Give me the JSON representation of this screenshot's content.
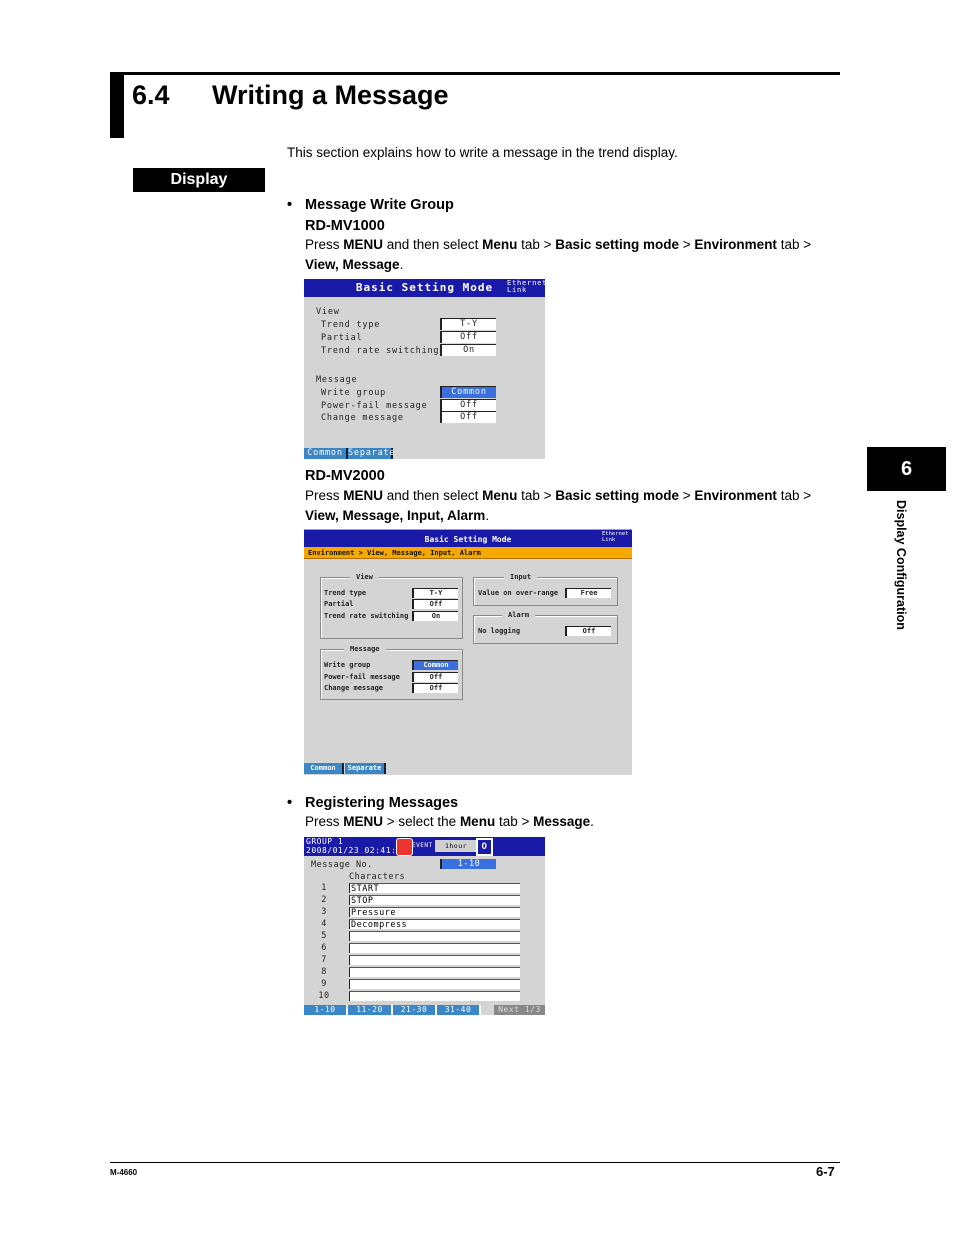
{
  "section": {
    "number": "6.4",
    "title": "Writing a Message",
    "intro": "This section explains how to write a message in the trend display."
  },
  "side_tag": "Display",
  "thumb": {
    "chapter": "6",
    "label": "Display Configuration"
  },
  "write_group": {
    "bullet": "•",
    "heading": "Message Write Group",
    "mv1000": {
      "model": "RD-MV1000",
      "instr": [
        {
          "t": "Press ",
          "b": false
        },
        {
          "t": "MENU",
          "b": true
        },
        {
          "t": " and then select ",
          "b": false
        },
        {
          "t": "Menu",
          "b": true
        },
        {
          "t": " tab > ",
          "b": false
        },
        {
          "t": "Basic setting mode",
          "b": true
        },
        {
          "t": " > ",
          "b": false
        },
        {
          "t": "Environment",
          "b": true
        },
        {
          "t": " tab > ",
          "b": false
        },
        {
          "t": "View, Message",
          "b": true
        },
        {
          "t": ".",
          "b": false
        }
      ],
      "screen": {
        "title": "Basic Setting Mode",
        "status": [
          "Ethernet",
          "Link"
        ],
        "view_label": "View",
        "view_rows": [
          {
            "label": "Trend type",
            "value": "T-Y"
          },
          {
            "label": "Partial",
            "value": "Off"
          },
          {
            "label": "Trend rate switching",
            "value": "On"
          }
        ],
        "message_label": "Message",
        "message_rows": [
          {
            "label": "Write group",
            "value": "Common",
            "selected": true
          },
          {
            "label": "Power-fail message",
            "value": "Off"
          },
          {
            "label": "Change message",
            "value": "Off"
          }
        ],
        "softkeys": [
          "Common",
          "Separate"
        ]
      }
    },
    "mv2000": {
      "model": "RD-MV2000",
      "instr": [
        {
          "t": "Press ",
          "b": false
        },
        {
          "t": "MENU",
          "b": true
        },
        {
          "t": " and then select ",
          "b": false
        },
        {
          "t": "Menu",
          "b": true
        },
        {
          "t": " tab > ",
          "b": false
        },
        {
          "t": "Basic setting mode",
          "b": true
        },
        {
          "t": " > ",
          "b": false
        },
        {
          "t": "Environment",
          "b": true
        },
        {
          "t": " tab > ",
          "b": false
        },
        {
          "t": "View, Message, Input, Alarm",
          "b": true
        },
        {
          "t": ".",
          "b": false
        }
      ],
      "screen": {
        "title": "Basic Setting Mode",
        "status": [
          "Ethernet",
          "Link"
        ],
        "breadcrumb": "Environment > View, Message, Input, Alarm",
        "view_label": "View",
        "view_rows": [
          {
            "label": "Trend type",
            "value": "T-Y"
          },
          {
            "label": "Partial",
            "value": "Off"
          },
          {
            "label": "Trend rate switching",
            "value": "On"
          }
        ],
        "message_label": "Message",
        "message_rows": [
          {
            "label": "Write group",
            "value": "Common",
            "selected": true
          },
          {
            "label": "Power-fail message",
            "value": "Off"
          },
          {
            "label": "Change message",
            "value": "Off"
          }
        ],
        "input_label": "Input",
        "input_rows": [
          {
            "label": "Value on over-range",
            "value": "Free"
          }
        ],
        "alarm_label": "Alarm",
        "alarm_rows": [
          {
            "label": "No logging",
            "value": "Off"
          }
        ],
        "softkeys": [
          "Common",
          "Separate"
        ]
      }
    }
  },
  "register": {
    "bullet": "•",
    "heading": "Registering Messages",
    "instr": [
      {
        "t": "Press ",
        "b": false
      },
      {
        "t": "MENU",
        "b": true
      },
      {
        "t": " > select the ",
        "b": false
      },
      {
        "t": "Menu",
        "b": true
      },
      {
        "t": " tab > ",
        "b": false
      },
      {
        "t": "Message",
        "b": true
      },
      {
        "t": ".",
        "b": false
      }
    ],
    "screen": {
      "group": "GROUP 1",
      "datetime": "2008/01/23 02:41:58",
      "event_label": "EVENT",
      "interval": "1hour",
      "camera_glyph": "O",
      "msgno_label": "Message No.",
      "msgno_value": "1-10",
      "chars_label": "Characters",
      "rows": [
        {
          "no": "1",
          "text": "START"
        },
        {
          "no": "2",
          "text": "STOP"
        },
        {
          "no": "3",
          "text": "Pressure"
        },
        {
          "no": "4",
          "text": "Decompress"
        },
        {
          "no": "5",
          "text": ""
        },
        {
          "no": "6",
          "text": ""
        },
        {
          "no": "7",
          "text": ""
        },
        {
          "no": "8",
          "text": ""
        },
        {
          "no": "9",
          "text": ""
        },
        {
          "no": "10",
          "text": ""
        }
      ],
      "softkeys": [
        "1-10",
        "11-20",
        "21-30",
        "31-40"
      ],
      "next": "Next 1/3"
    }
  },
  "footer": {
    "doc_id": "M-4660",
    "page": "6-7"
  }
}
